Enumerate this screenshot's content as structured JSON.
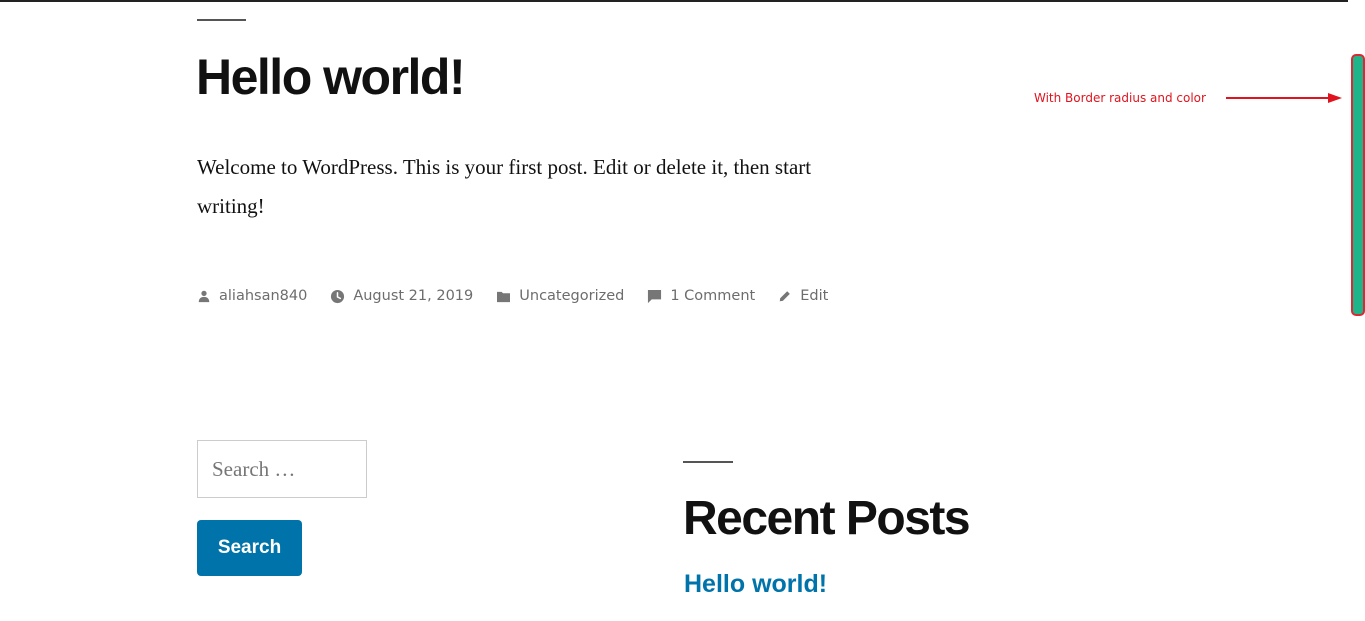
{
  "post": {
    "title": "Hello world!",
    "body": "Welcome to WordPress. This is your first post. Edit or delete it, then start writing!",
    "meta": {
      "author": "aliahsan840",
      "date": "August 21, 2019",
      "category": "Uncategorized",
      "comments": "1 Comment",
      "edit": "Edit"
    }
  },
  "annotation": {
    "text": "With Border radius and color",
    "color": "#e0141e"
  },
  "scrollbar": {
    "thumb_color": "#1fb58a",
    "thumb_border_color": "#d92a34"
  },
  "search": {
    "placeholder": "Search …",
    "button_label": "Search"
  },
  "recent_posts": {
    "title": "Recent Posts",
    "items": [
      {
        "label": "Hello world!"
      }
    ]
  },
  "colors": {
    "link": "#0073aa",
    "button_bg": "#0073aa",
    "meta_text": "#767676"
  }
}
